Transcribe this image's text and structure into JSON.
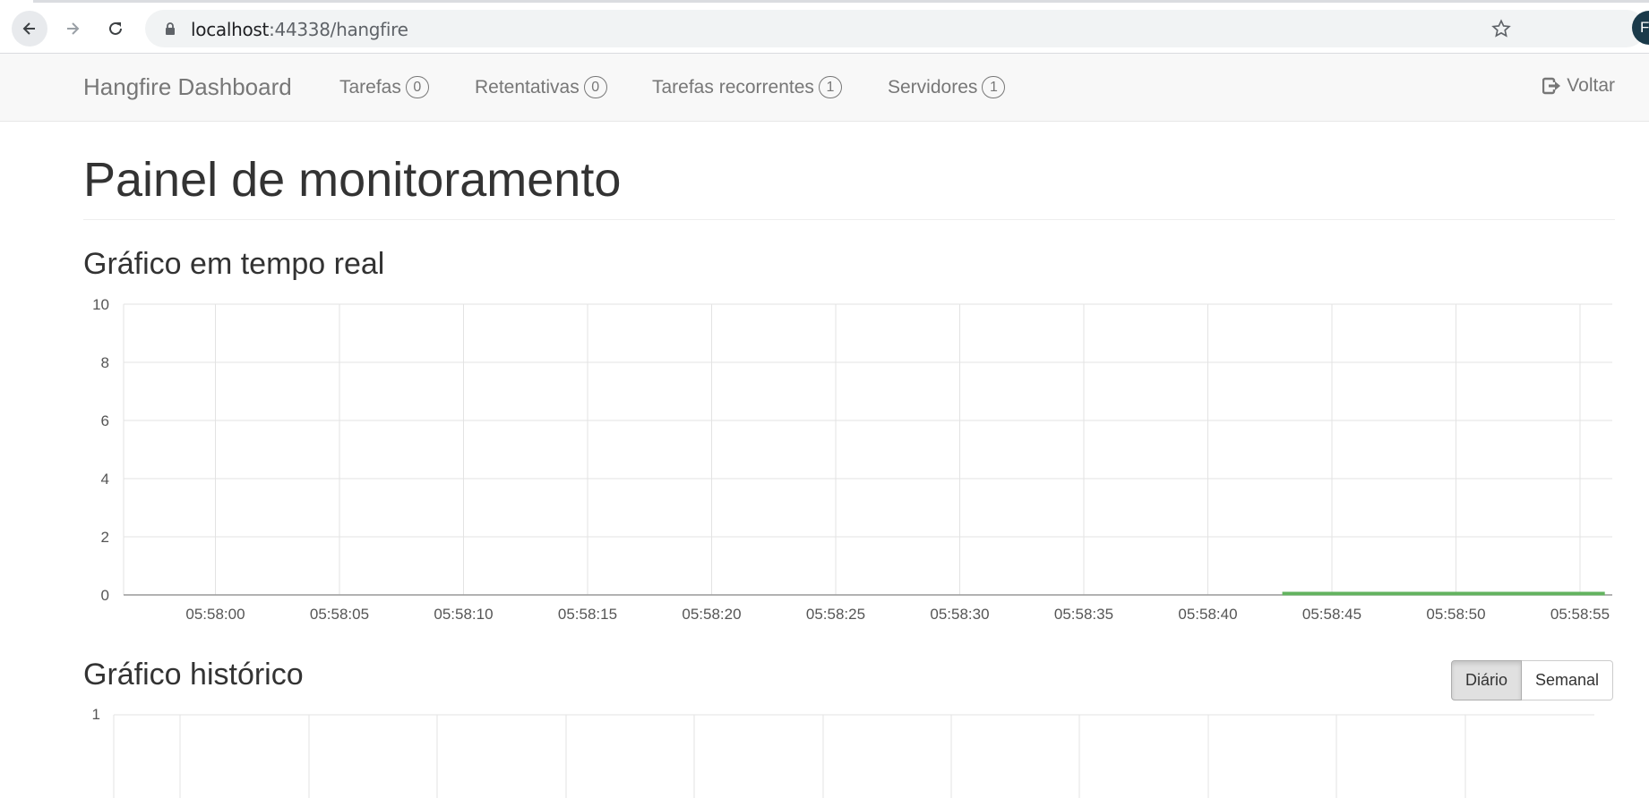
{
  "browser": {
    "url_host": "localhost",
    "url_rest": ":44338/hangfire",
    "profile_initial": "F"
  },
  "navbar": {
    "brand": "Hangfire Dashboard",
    "items": [
      {
        "label": "Tarefas",
        "count": "0"
      },
      {
        "label": "Retentativas",
        "count": "0"
      },
      {
        "label": "Tarefas recorrentes",
        "count": "1"
      },
      {
        "label": "Servidores",
        "count": "1"
      }
    ],
    "back_label": "Voltar"
  },
  "main": {
    "page_title": "Painel de monitoramento",
    "realtime_title": "Gráfico em tempo real",
    "history_title": "Gráfico histórico",
    "period_buttons": [
      {
        "label": "Diário",
        "active": true
      },
      {
        "label": "Semanal",
        "active": false
      }
    ]
  },
  "chart_data": [
    {
      "type": "line",
      "title": "Gráfico em tempo real",
      "ylim": [
        0,
        10
      ],
      "y_ticks": [
        "0",
        "2",
        "4",
        "6",
        "8",
        "10"
      ],
      "x_ticks": [
        "05:58:00",
        "05:58:05",
        "05:58:10",
        "05:58:15",
        "05:58:20",
        "05:58:25",
        "05:58:30",
        "05:58:35",
        "05:58:40",
        "05:58:45",
        "05:58:50",
        "05:58:55"
      ],
      "series": [
        {
          "color": "#62b35f",
          "x": [
            "05:58:43",
            "05:58:56"
          ],
          "values": [
            0,
            0
          ]
        }
      ],
      "grid": true
    },
    {
      "type": "line",
      "title": "Gráfico histórico",
      "y_ticks": [
        "1"
      ],
      "grid": true
    }
  ]
}
